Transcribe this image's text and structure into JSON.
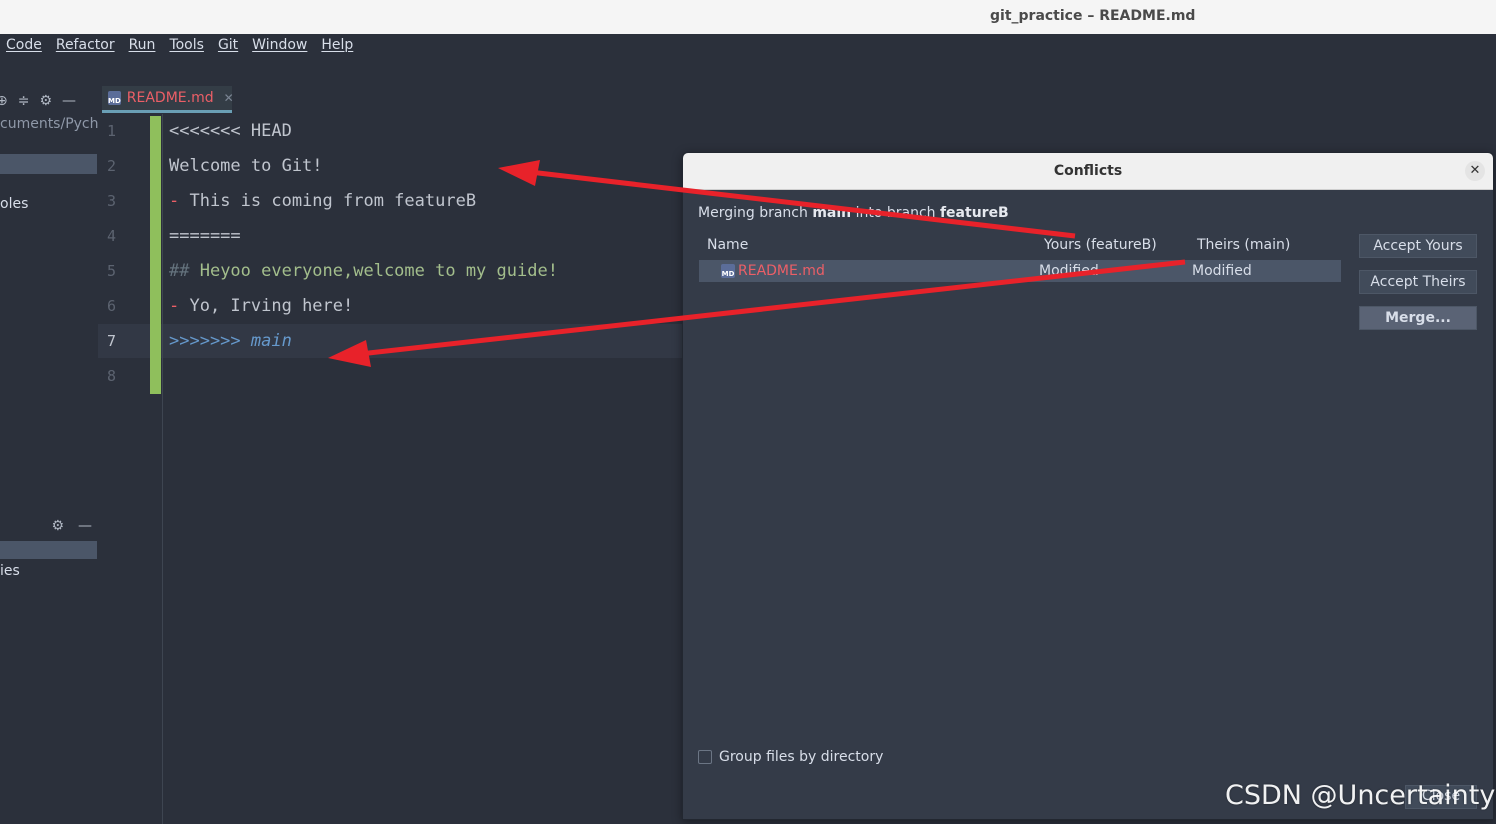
{
  "window": {
    "title": "git_practice – README.md"
  },
  "menu": [
    "Code",
    "Refactor",
    "Run",
    "Tools",
    "Git",
    "Window",
    "Help"
  ],
  "left_panel": {
    "path": "cuments/Pycha",
    "label1": "oles",
    "label2": "ies"
  },
  "tab": {
    "name": "README.md"
  },
  "editor": {
    "lines": [
      {
        "no": "1",
        "text": "<<<<<<< HEAD"
      },
      {
        "no": "2",
        "text": "Welcome to Git!"
      },
      {
        "no": "3",
        "dash": "- ",
        "text": "This is coming from featureB"
      },
      {
        "no": "4",
        "text": "======="
      },
      {
        "no": "5",
        "hashes": "## ",
        "text": "Heyoo everyone,welcome to my guide!"
      },
      {
        "no": "6",
        "dash": "- ",
        "text": "Yo, Irving here!"
      },
      {
        "no": "7",
        "marker": ">>>>>>> ",
        "text": "main"
      },
      {
        "no": "8",
        "text": ""
      }
    ]
  },
  "dialog": {
    "title": "Conflicts",
    "message_prefix": "Merging branch ",
    "source_branch": "main",
    "message_mid": " into branch ",
    "target_branch": "featureB",
    "columns": {
      "name": "Name",
      "yours": "Yours (featureB)",
      "theirs": "Theirs (main)"
    },
    "row": {
      "file": "README.md",
      "yours": "Modified",
      "theirs": "Modified"
    },
    "buttons": {
      "accept_yours": "Accept Yours",
      "accept_theirs": "Accept Theirs",
      "merge": "Merge..."
    },
    "group_by_dir": "Group files by directory",
    "close": "Close"
  },
  "watermark": "CSDN @Uncertainty!!",
  "colors": {
    "accent_green": "#8fbf5c",
    "conflict_red": "#ec5f67",
    "annotation_arrow": "#e8222a"
  }
}
